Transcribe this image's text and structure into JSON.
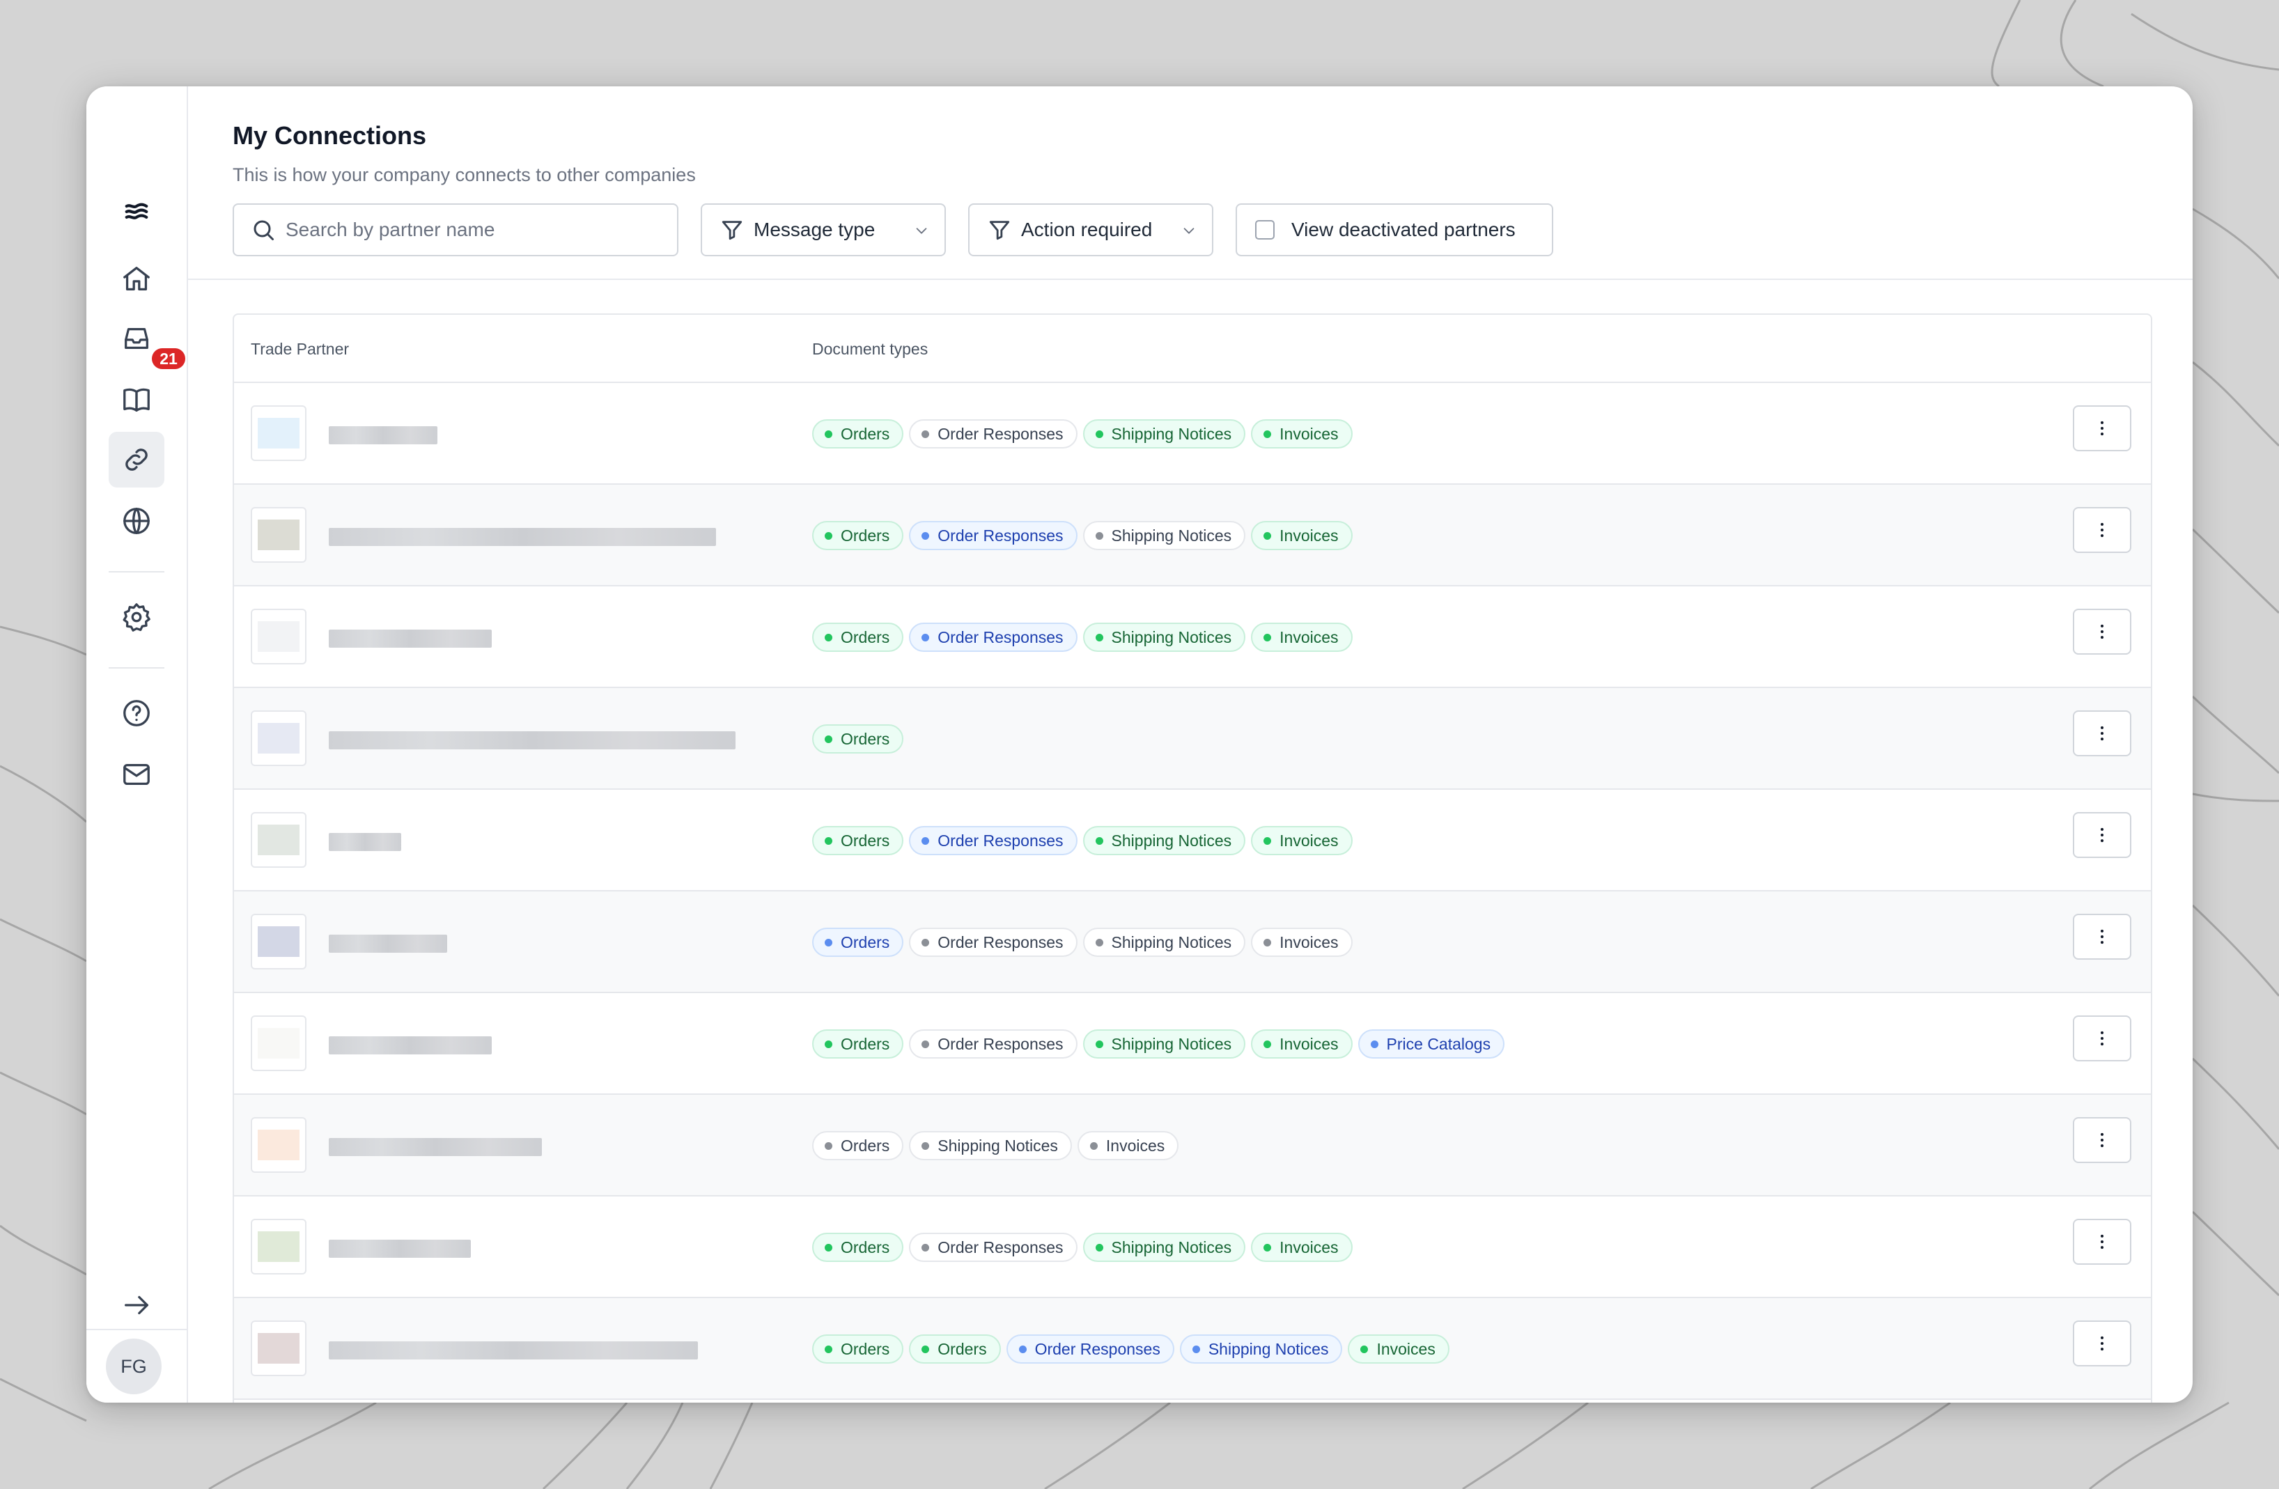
{
  "sidebar": {
    "inbox_badge": "21",
    "avatar_initials": "FG"
  },
  "header": {
    "title": "My Connections",
    "subtitle": "This is how your company connects to other companies"
  },
  "filters": {
    "search_placeholder": "Search by partner name",
    "message_type_label": "Message type",
    "action_required_label": "Action required",
    "view_deactivated_label": "View deactivated partners",
    "view_deactivated_checked": false
  },
  "table": {
    "columns": [
      "Trade Partner",
      "Document types"
    ],
    "rows": [
      {
        "logo_color": "#e3f1fb",
        "name_blur_width": 156,
        "chips": [
          {
            "label": "Orders",
            "status": "green"
          },
          {
            "label": "Order Responses",
            "status": "gray"
          },
          {
            "label": "Shipping Notices",
            "status": "green"
          },
          {
            "label": "Invoices",
            "status": "green"
          }
        ]
      },
      {
        "logo_color": "#dcdcd4",
        "name_blur_width": 556,
        "chips": [
          {
            "label": "Orders",
            "status": "green"
          },
          {
            "label": "Order Responses",
            "status": "blue"
          },
          {
            "label": "Shipping Notices",
            "status": "gray"
          },
          {
            "label": "Invoices",
            "status": "green"
          }
        ]
      },
      {
        "logo_color": "#f2f3f5",
        "name_blur_width": 234,
        "chips": [
          {
            "label": "Orders",
            "status": "green"
          },
          {
            "label": "Order Responses",
            "status": "blue"
          },
          {
            "label": "Shipping Notices",
            "status": "green"
          },
          {
            "label": "Invoices",
            "status": "green"
          }
        ]
      },
      {
        "logo_color": "#e6e9f3",
        "name_blur_width": 584,
        "chips": [
          {
            "label": "Orders",
            "status": "green"
          }
        ]
      },
      {
        "logo_color": "#e2e7e2",
        "name_blur_width": 104,
        "chips": [
          {
            "label": "Orders",
            "status": "green"
          },
          {
            "label": "Order Responses",
            "status": "blue"
          },
          {
            "label": "Shipping Notices",
            "status": "green"
          },
          {
            "label": "Invoices",
            "status": "green"
          }
        ]
      },
      {
        "logo_color": "#d3d7e6",
        "name_blur_width": 170,
        "chips": [
          {
            "label": "Orders",
            "status": "blue"
          },
          {
            "label": "Order Responses",
            "status": "gray"
          },
          {
            "label": "Shipping Notices",
            "status": "gray"
          },
          {
            "label": "Invoices",
            "status": "gray"
          }
        ]
      },
      {
        "logo_color": "#f8f8f6",
        "name_blur_width": 234,
        "chips": [
          {
            "label": "Orders",
            "status": "green"
          },
          {
            "label": "Order Responses",
            "status": "gray"
          },
          {
            "label": "Shipping Notices",
            "status": "green"
          },
          {
            "label": "Invoices",
            "status": "green"
          },
          {
            "label": "Price Catalogs",
            "status": "blue"
          }
        ]
      },
      {
        "logo_color": "#fbe9dd",
        "name_blur_width": 306,
        "chips": [
          {
            "label": "Orders",
            "status": "gray"
          },
          {
            "label": "Shipping Notices",
            "status": "gray"
          },
          {
            "label": "Invoices",
            "status": "gray"
          }
        ]
      },
      {
        "logo_color": "#e0ead8",
        "name_blur_width": 204,
        "chips": [
          {
            "label": "Orders",
            "status": "green"
          },
          {
            "label": "Order Responses",
            "status": "gray"
          },
          {
            "label": "Shipping Notices",
            "status": "green"
          },
          {
            "label": "Invoices",
            "status": "green"
          }
        ]
      },
      {
        "logo_color": "#e3d8d8",
        "name_blur_width": 530,
        "chips": [
          {
            "label": "Orders",
            "status": "green"
          },
          {
            "label": "Orders",
            "status": "green"
          },
          {
            "label": "Order Responses",
            "status": "blue"
          },
          {
            "label": "Shipping Notices",
            "status": "blue"
          },
          {
            "label": "Invoices",
            "status": "green"
          }
        ]
      }
    ]
  }
}
